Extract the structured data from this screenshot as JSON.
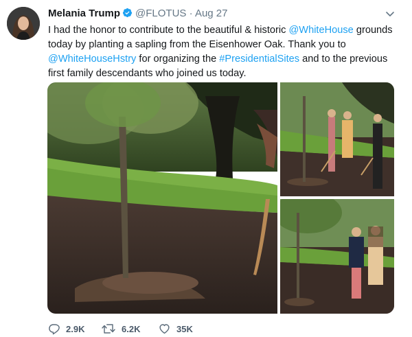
{
  "author": {
    "name": "Melania Trump",
    "handle": "@FLOTUS",
    "separator": "·",
    "date": "Aug 27"
  },
  "tweet": {
    "segments": [
      {
        "text": "I had the honor to contribute to the beautiful & historic ",
        "link": false
      },
      {
        "text": "@WhiteHouse",
        "link": true
      },
      {
        "text": " grounds today by planting a sapling from the Eisenhower Oak.  Thank you to ",
        "link": false
      },
      {
        "text": "@WhiteHouseHstry",
        "link": true
      },
      {
        "text": " for organizing the ",
        "link": false
      },
      {
        "text": "#PresidentialSites",
        "link": true
      },
      {
        "text": " and to the previous first family descendants who joined us today.",
        "link": false
      }
    ]
  },
  "media": {
    "photos": [
      "main-photo",
      "top-right-photo",
      "bottom-right-photo"
    ]
  },
  "actions": {
    "replies": "2.9K",
    "retweets": "6.2K",
    "likes": "35K"
  },
  "icons": {
    "verified": "verified-badge-icon",
    "more": "chevron-down-icon",
    "reply": "reply-icon",
    "retweet": "retweet-icon",
    "like": "heart-icon"
  },
  "colors": {
    "link": "#1da1f2",
    "verified": "#1da1f2",
    "text": "#14171a",
    "muted": "#657786"
  }
}
